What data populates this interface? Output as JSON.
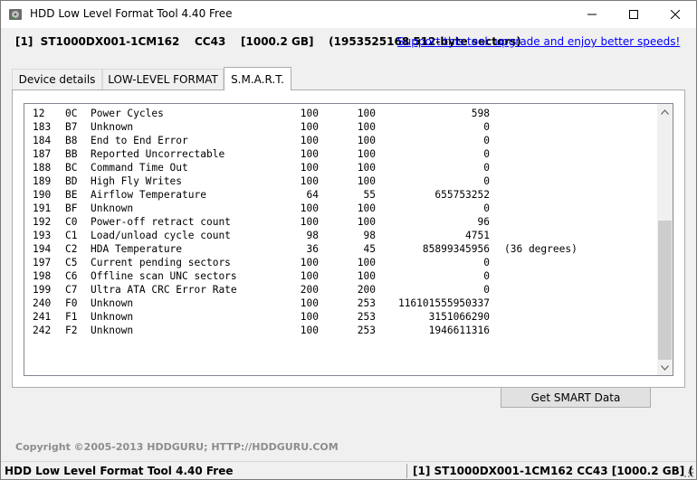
{
  "window": {
    "title": "HDD Low Level Format Tool 4.40   Free"
  },
  "drive_info": "[1]  ST1000DX001-1CM162    CC43    [1000.2 GB]    (1953525168 512-byte sectors)",
  "support_link": "Support this tool: upgrade and enjoy better speeds!",
  "tabs": [
    {
      "label": "Device details"
    },
    {
      "label": "LOW-LEVEL FORMAT"
    },
    {
      "label": "S.M.A.R.T."
    }
  ],
  "smart_rows": [
    {
      "id": "12",
      "hex": "0C",
      "attr": "Power Cycles",
      "value": "100",
      "worst": "100",
      "raw": "598",
      "note": ""
    },
    {
      "id": "183",
      "hex": "B7",
      "attr": "Unknown",
      "value": "100",
      "worst": "100",
      "raw": "0",
      "note": ""
    },
    {
      "id": "184",
      "hex": "B8",
      "attr": "End to End Error",
      "value": "100",
      "worst": "100",
      "raw": "0",
      "note": ""
    },
    {
      "id": "187",
      "hex": "BB",
      "attr": "Reported Uncorrectable",
      "value": "100",
      "worst": "100",
      "raw": "0",
      "note": ""
    },
    {
      "id": "188",
      "hex": "BC",
      "attr": "Command Time Out",
      "value": "100",
      "worst": "100",
      "raw": "0",
      "note": ""
    },
    {
      "id": "189",
      "hex": "BD",
      "attr": "High Fly Writes",
      "value": "100",
      "worst": "100",
      "raw": "0",
      "note": ""
    },
    {
      "id": "190",
      "hex": "BE",
      "attr": "Airflow Temperature",
      "value": "64",
      "worst": "55",
      "raw": "655753252",
      "note": ""
    },
    {
      "id": "191",
      "hex": "BF",
      "attr": "Unknown",
      "value": "100",
      "worst": "100",
      "raw": "0",
      "note": ""
    },
    {
      "id": "192",
      "hex": "C0",
      "attr": "Power-off retract count",
      "value": "100",
      "worst": "100",
      "raw": "96",
      "note": ""
    },
    {
      "id": "193",
      "hex": "C1",
      "attr": "Load/unload cycle count",
      "value": "98",
      "worst": "98",
      "raw": "4751",
      "note": ""
    },
    {
      "id": "194",
      "hex": "C2",
      "attr": "HDA Temperature",
      "value": "36",
      "worst": "45",
      "raw": "85899345956",
      "note": "(36 degrees)"
    },
    {
      "id": "197",
      "hex": "C5",
      "attr": "Current pending sectors",
      "value": "100",
      "worst": "100",
      "raw": "0",
      "note": ""
    },
    {
      "id": "198",
      "hex": "C6",
      "attr": "Offline scan UNC sectors",
      "value": "100",
      "worst": "100",
      "raw": "0",
      "note": ""
    },
    {
      "id": "199",
      "hex": "C7",
      "attr": "Ultra ATA CRC Error Rate",
      "value": "200",
      "worst": "200",
      "raw": "0",
      "note": ""
    },
    {
      "id": "240",
      "hex": "F0",
      "attr": "Unknown",
      "value": "100",
      "worst": "253",
      "raw": "116101555950337",
      "note": ""
    },
    {
      "id": "241",
      "hex": "F1",
      "attr": "Unknown",
      "value": "100",
      "worst": "253",
      "raw": "3151066290",
      "note": ""
    },
    {
      "id": "242",
      "hex": "F2",
      "attr": "Unknown",
      "value": "100",
      "worst": "253",
      "raw": "1946611316",
      "note": ""
    }
  ],
  "buttons": {
    "get_smart": "Get SMART Data"
  },
  "copyright": "Copyright ©2005-2013 HDDGURU;  HTTP://HDDGURU.COM",
  "statusbar": {
    "left": "HDD Low Level Format Tool 4.40    Free",
    "right": "[1]  ST1000DX001-1CM162    CC43    [1000.2 GB]    ("
  },
  "colors": {
    "link": "#0000ff",
    "window_bg": "#f0f0f0",
    "copyright": "#8d8d8d"
  }
}
